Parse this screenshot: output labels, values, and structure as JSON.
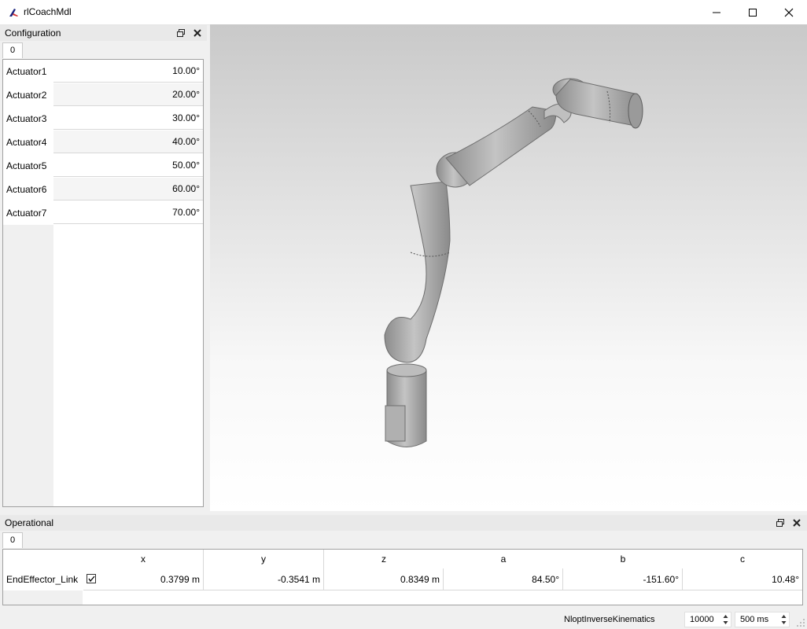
{
  "window": {
    "title": "rlCoachMdl",
    "icon": "app-icon"
  },
  "configuration": {
    "title": "Configuration",
    "tab": "0",
    "rows": [
      {
        "label": "Actuator1",
        "value": "10.00°"
      },
      {
        "label": "Actuator2",
        "value": "20.00°"
      },
      {
        "label": "Actuator3",
        "value": "30.00°"
      },
      {
        "label": "Actuator4",
        "value": "40.00°"
      },
      {
        "label": "Actuator5",
        "value": "50.00°"
      },
      {
        "label": "Actuator6",
        "value": "60.00°"
      },
      {
        "label": "Actuator7",
        "value": "70.00°"
      }
    ]
  },
  "operational": {
    "title": "Operational",
    "tab": "0",
    "columns": [
      "x",
      "y",
      "z",
      "a",
      "b",
      "c"
    ],
    "row": {
      "label": "EndEffector_Link",
      "checked": true,
      "values": [
        "0.3799 m",
        "-0.3541 m",
        "0.8349 m",
        "84.50°",
        "-151.60°",
        "10.48°"
      ]
    }
  },
  "status": {
    "ik_method": "NloptInverseKinematics",
    "iterations": "10000",
    "duration": "500 ms"
  },
  "colors": {
    "viewport_top": "#c9c9c9",
    "viewport_bottom": "#ffffff",
    "robot": "#a9a9a9"
  }
}
